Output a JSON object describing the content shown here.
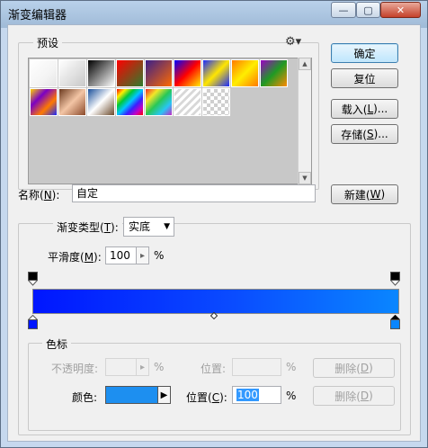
{
  "window": {
    "title": "渐变编辑器"
  },
  "presets": {
    "label": "预设",
    "swatches": [
      {
        "name": "foreground-to-background",
        "background": "linear-gradient(135deg,#ffffff,#f4f4f4 60%,#e5e5e5)"
      },
      {
        "name": "foreground-to-transparent",
        "background": "linear-gradient(135deg,#ffffff,rgba(255,255,255,0))"
      },
      {
        "name": "black-white",
        "background": "linear-gradient(135deg,#000,#fff)"
      },
      {
        "name": "red-green",
        "background": "linear-gradient(135deg,#ff0000,#2d7d2d)"
      },
      {
        "name": "violet-orange",
        "background": "linear-gradient(135deg,#3a1f8a,#ff6a00)"
      },
      {
        "name": "blue-red-yellow",
        "background": "linear-gradient(135deg,#0000ff,#ff0000,#ffee00)"
      },
      {
        "name": "blue-yellow-blue",
        "background": "linear-gradient(135deg,#1a2bff,#ffe600,#1a2bff)"
      },
      {
        "name": "orange-yellow-orange",
        "background": "linear-gradient(135deg,#ff7a00,#ffee00,#ff7a00)"
      },
      {
        "name": "violet-green-orange",
        "background": "linear-gradient(135deg,#9b00c4,#1f9a24,#ff8a00)"
      },
      {
        "name": "yellow-violet-orange-blue",
        "background": "linear-gradient(135deg,#ffd400,#7a00c4,#ff7a00,#1a2bff)"
      },
      {
        "name": "copper",
        "background": "linear-gradient(135deg,#6b3a1f,#f3c5a5,#8b4a2b)"
      },
      {
        "name": "chrome",
        "background": "linear-gradient(135deg,#1a4f9a,#ffffff,#6b4a2b)"
      },
      {
        "name": "spectrum",
        "background": "linear-gradient(135deg,#ff0000,#ffee00,#00c83a,#00c6ff,#3a1fff,#c400c4,#ff0000)"
      },
      {
        "name": "transparent-rainbow",
        "background": "linear-gradient(135deg,rgba(255,0,0,0.8),rgba(255,238,0,0.8),rgba(0,200,58,0.8),rgba(0,198,255,0.8),rgba(196,0,196,0.8))"
      },
      {
        "name": "transparent-stripes",
        "background": "repeating-linear-gradient(135deg,#ffffff 0,#ffffff 3px,#d8d8d8 3px,#d8d8d8 6px)"
      },
      {
        "name": "transparent-checker",
        "background": "checker"
      }
    ]
  },
  "buttons": {
    "ok": "确定",
    "reset": "复位",
    "load": "载入(L)...",
    "save": "存储(S)...",
    "new": "新建(W)",
    "delete_opacity": "删除(D)",
    "delete_color": "删除(D)"
  },
  "name_field": {
    "label": "名称(N):",
    "value": "自定"
  },
  "gradient": {
    "type_label": "渐变类型(T):",
    "type_value": "实底",
    "smoothness_label": "平滑度(M):",
    "smoothness_value": "100",
    "smoothness_unit": "%"
  },
  "color_stops": {
    "label": "色标",
    "opacity_label": "不透明度:",
    "opacity_value": "",
    "opacity_unit": "%",
    "opacity_location_label": "位置:",
    "opacity_location_value": "",
    "opacity_location_unit": "%",
    "color_label": "颜色:",
    "color_value": "#1d8ff0",
    "location_label": "位置(C):",
    "location_value": "100",
    "location_unit": "%"
  },
  "colors": {
    "stop_left": "#0016ff",
    "stop_right": "#0a86ff"
  }
}
